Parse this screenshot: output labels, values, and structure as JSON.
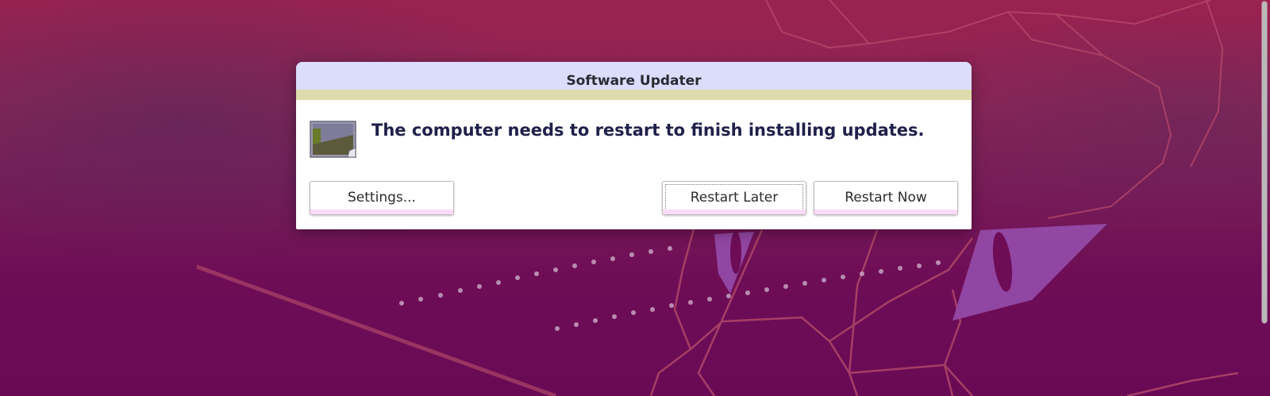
{
  "dialog": {
    "title": "Software Updater",
    "icon": "image-file-icon",
    "message": "The computer needs to restart to finish installing updates."
  },
  "buttons": {
    "settings": "Settings...",
    "restart_later": "Restart Later",
    "restart_now": "Restart Now"
  },
  "colors": {
    "titlebar_bg": "#dcdcfb",
    "titlebar_accent": "#dedcaa",
    "button_accent": "#fbdcfb",
    "message_text": "#20204a",
    "wallpaper_base": "#6e0d56",
    "wallpaper_top": "#9a2250",
    "wallpaper_accent": "#944aa8"
  }
}
